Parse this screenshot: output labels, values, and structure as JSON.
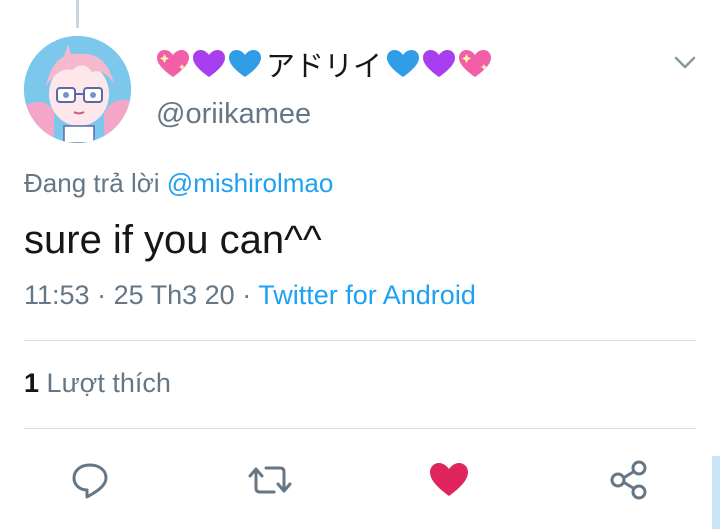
{
  "tweet": {
    "display_name_text": "アドリイ",
    "display_name_emojis": [
      "sparkling-heart",
      "purple-heart",
      "blue-heart",
      "blue-heart",
      "purple-heart",
      "sparkling-heart"
    ],
    "username": "@oriikamee",
    "reply_prefix": "Đang trả lời",
    "reply_mention": "@mishirolmao",
    "text": "sure if you can^^",
    "time": "11:53",
    "separator": "·",
    "date": "25 Th3 20",
    "source": "Twitter for Android"
  },
  "stats": {
    "like_count": "1",
    "like_label": "Lượt thích"
  },
  "actions": [
    {
      "icon": "reply-icon"
    },
    {
      "icon": "retweet-icon"
    },
    {
      "icon": "like-icon",
      "color": "#e0245e"
    },
    {
      "icon": "share-icon"
    }
  ],
  "colors": {
    "link": "#1da1f2",
    "secondary_text": "#657786",
    "primary_text": "#14171a",
    "divider": "#d8dee3",
    "like_active": "#e0245e"
  }
}
